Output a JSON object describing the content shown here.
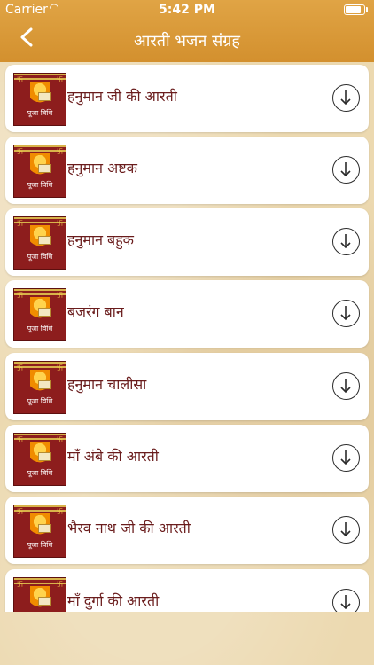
{
  "status_bar": {
    "carrier": "Carrier",
    "time": "5:42 PM"
  },
  "header": {
    "title": "आरती भजन संग्रह"
  },
  "thumbnail_label": "पूजा विधि",
  "items": [
    {
      "title": "हनुमान जी की आरती"
    },
    {
      "title": "हनुमान अष्टक"
    },
    {
      "title": "हनुमान बहुक"
    },
    {
      "title": "बजरंग बान"
    },
    {
      "title": "हनुमान चालीसा"
    },
    {
      "title": "माँ अंबे की आरती"
    },
    {
      "title": "भैरव नाथ जी की आरती"
    },
    {
      "title": "माँ दुर्गा की आरती"
    }
  ],
  "icons": {
    "back": "chevron-left-icon",
    "download": "download-arrow-icon",
    "wifi": "wifi-icon",
    "battery": "battery-icon"
  },
  "colors": {
    "header": "#d99b3a",
    "item_text": "#6a1c1c",
    "thumb_bg": "#8d1d1d"
  }
}
